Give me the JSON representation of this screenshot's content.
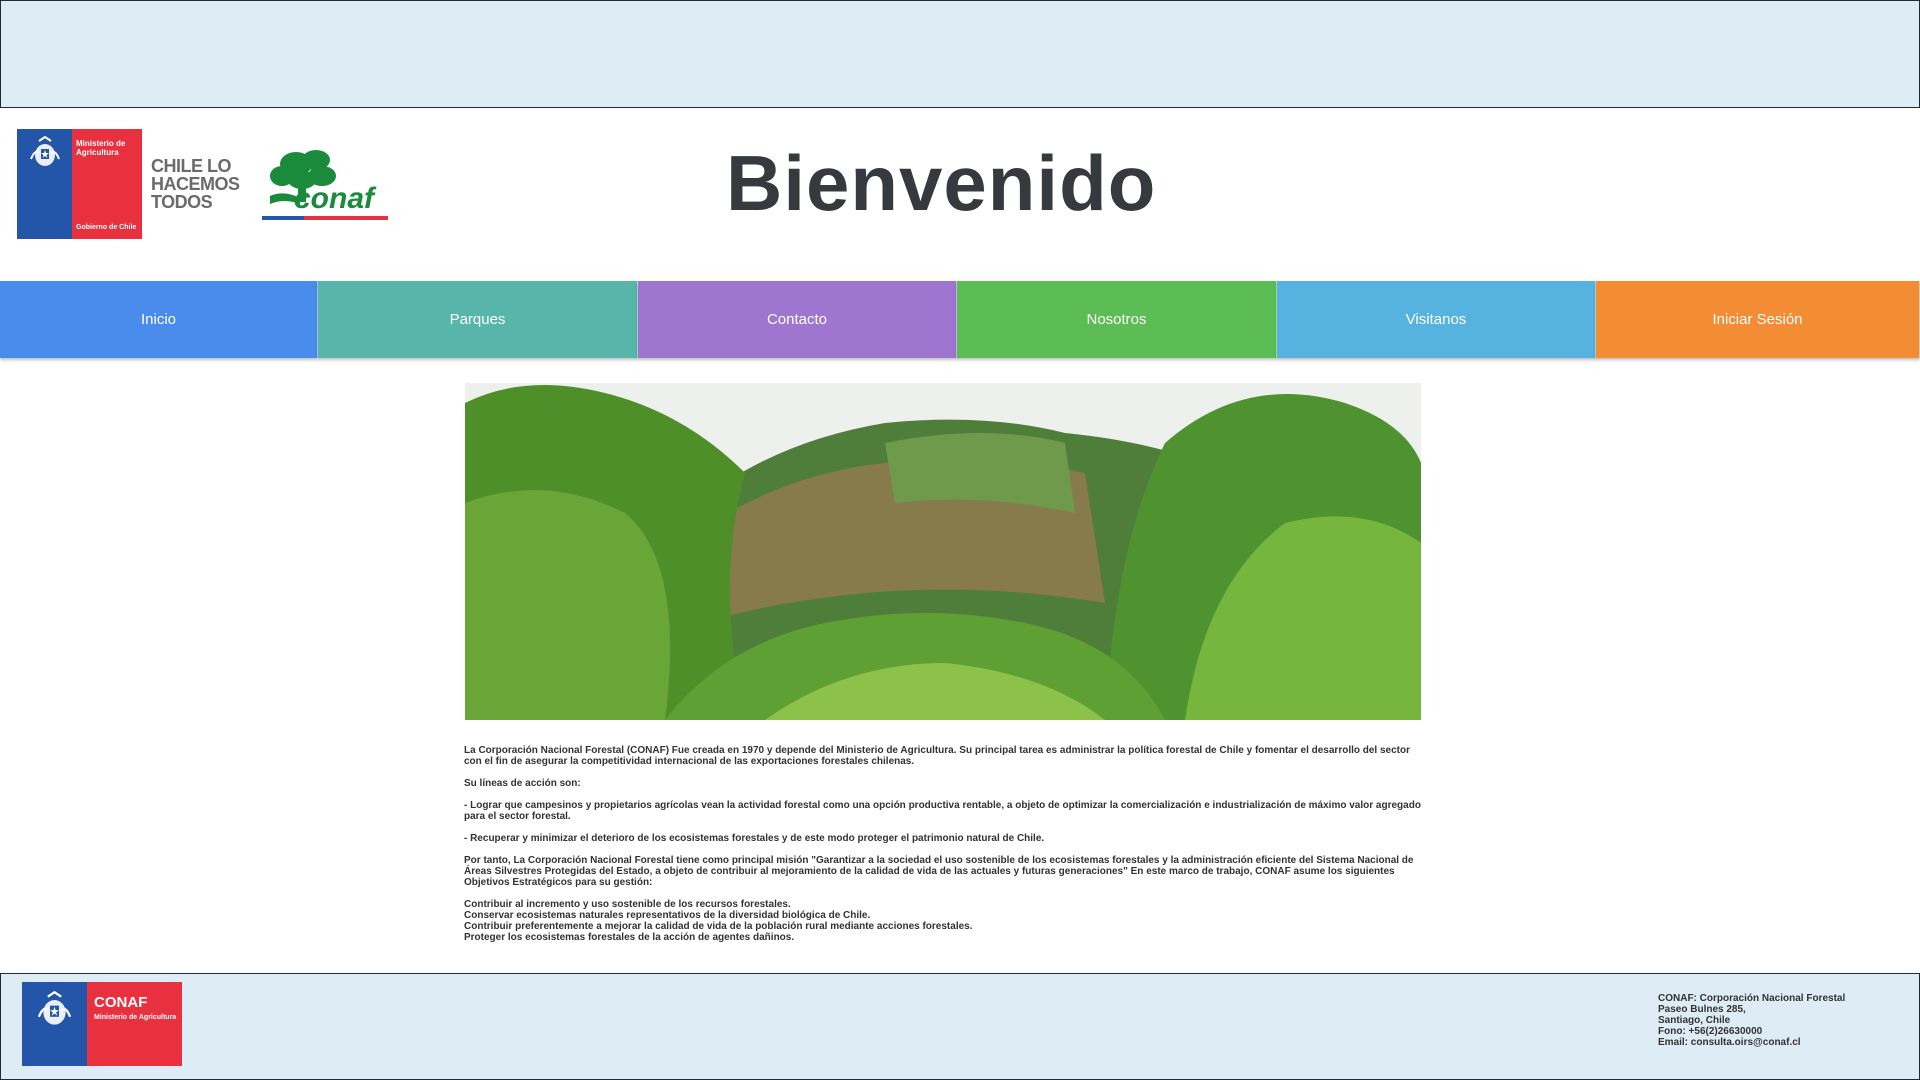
{
  "header": {
    "ministry_name": "Ministerio de Agricultura",
    "ministry_footer": "Gobierno de Chile",
    "slogan": [
      "CHILE LO",
      "HACEMOS",
      "TODOS"
    ],
    "conaf_logo_text": "conaf",
    "title": "Bienvenido"
  },
  "nav": {
    "items": [
      {
        "label": "Inicio",
        "color": "#4a8cec"
      },
      {
        "label": "Parques",
        "color": "#57b6a9"
      },
      {
        "label": "Contacto",
        "color": "#9e76cf"
      },
      {
        "label": "Nosotros",
        "color": "#5cbd55"
      },
      {
        "label": "Visitanos",
        "color": "#56b3e0"
      },
      {
        "label": "Iniciar Sesión",
        "color": "#f28d35"
      }
    ]
  },
  "content": {
    "intro": "La Corporación Nacional Forestal (CONAF) Fue creada en 1970 y depende del Ministerio de Agricultura. Su principal tarea es administrar la política forestal de Chile y fomentar el desarrollo del sector con el fin de asegurar la competitividad internacional de las exportaciones forestales chilenas.",
    "lines_heading": "Su líneas de acción son:",
    "line1": "- Lograr que campesinos y propietarios agrícolas vean la actividad forestal como una opción productiva rentable, a objeto de optimizar la comercialización e industrialización de máximo valor agregado para el sector forestal.",
    "line2": "- Recuperar y minimizar el deterioro de los ecosistemas forestales y de este modo proteger el patrimonio natural de Chile.",
    "mission": "Por tanto, La Corporación Nacional Forestal tiene como principal misión \"Garantizar a la sociedad el uso sostenible de los ecosistemas forestales y la administración eficiente del Sistema Nacional de Áreas Silvestres Protegidas del Estado, a objeto de contribuir al mejoramiento de la calidad de vida de las actuales y futuras generaciones\" En este marco de trabajo, CONAF asume los siguientes Objetivos Estratégicos para su gestión:",
    "goals": [
      "Contribuir al incremento y uso sostenible de los recursos forestales.",
      "Conservar ecosistemas naturales representativos de la diversidad biológica de Chile.",
      "Contribuir preferentemente a mejorar la calidad de vida de la población rural mediante acciones forestales.",
      "Proteger los ecosistemas forestales de la acción de agentes dañinos."
    ]
  },
  "footer": {
    "brand": "CONAF",
    "brand_sub": "Ministerio de Agricultura",
    "contact": [
      "CONAF: Corporación Nacional Forestal",
      "Paseo Bulnes 285,",
      " Santiago, Chile",
      "Fono: +56(2)26630000",
      "Email: consulta.oirs@conaf.cl"
    ]
  }
}
